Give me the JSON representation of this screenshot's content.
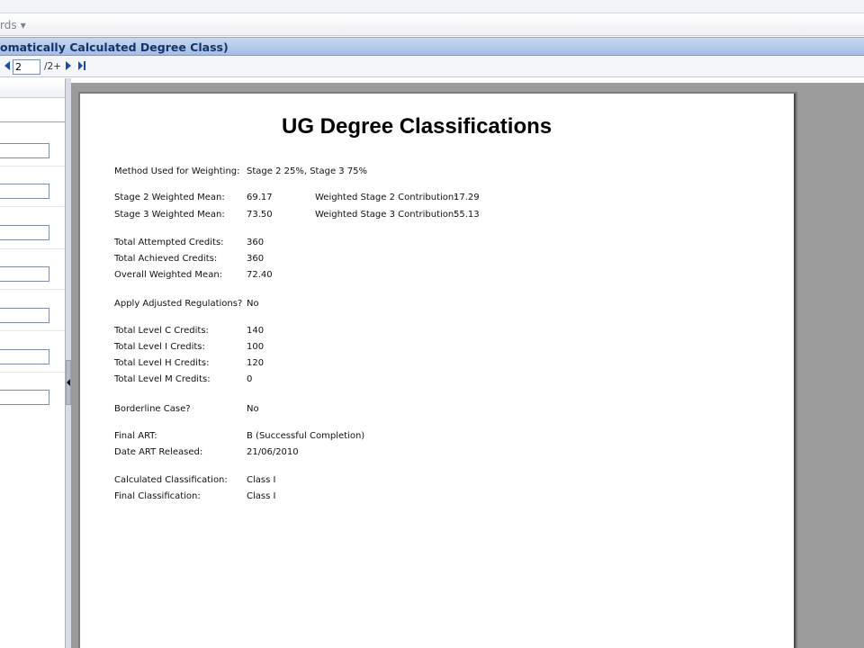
{
  "menubar": {
    "item_label": "rds"
  },
  "window": {
    "title": "omatically Calculated Degree Class)"
  },
  "toolbar": {
    "page_value": "2",
    "page_total": "/2+"
  },
  "report": {
    "title": "UG Degree Classifications",
    "rows": {
      "method_label": "Method Used for Weighting:",
      "method_value": "Stage 2 25%, Stage 3 75%",
      "s2_mean_label": "Stage 2 Weighted Mean:",
      "s2_mean_value": "69.17",
      "s2_contrib_label": "Weighted Stage 2 Contribution:",
      "s2_contrib_value": "17.29",
      "s3_mean_label": "Stage 3 Weighted Mean:",
      "s3_mean_value": "73.50",
      "s3_contrib_label": "Weighted Stage 3 Contribution:",
      "s3_contrib_value": "55.13",
      "attempted_label": "Total Attempted Credits:",
      "attempted_value": "360",
      "achieved_label": "Total Achieved Credits:",
      "achieved_value": "360",
      "overall_label": "Overall Weighted Mean:",
      "overall_value": "72.40",
      "adjusted_label": "Apply Adjusted Regulations?",
      "adjusted_value": "No",
      "level_c_label": "Total Level C Credits:",
      "level_c_value": "140",
      "level_i_label": "Total Level I Credits:",
      "level_i_value": "100",
      "level_h_label": "Total Level H Credits:",
      "level_h_value": "120",
      "level_m_label": "Total Level M Credits:",
      "level_m_value": "0",
      "borderline_label": "Borderline Case?",
      "borderline_value": "No",
      "final_art_label": "Final ART:",
      "final_art_value": "B (Successful Completion)",
      "art_date_label": "Date ART Released:",
      "art_date_value": "21/06/2010",
      "calc_class_label": "Calculated Classification:",
      "calc_class_value": "Class I",
      "final_class_label": "Final Classification:",
      "final_class_value": "Class I"
    }
  }
}
